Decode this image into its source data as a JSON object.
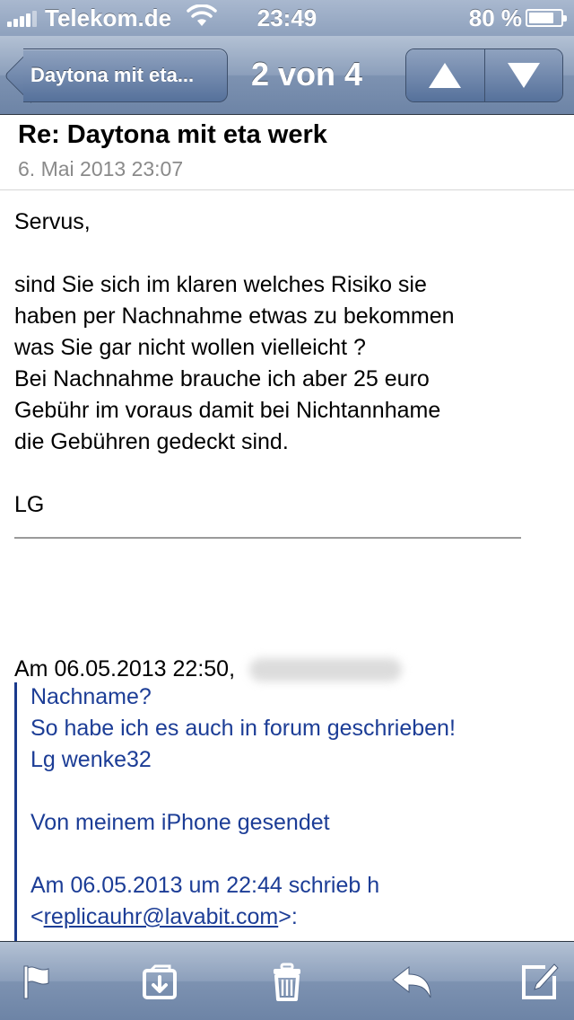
{
  "status_bar": {
    "carrier": "Telekom.de",
    "time": "23:49",
    "battery_percent": "80 %",
    "battery_level": 0.8,
    "signal_bars": 4
  },
  "nav": {
    "back_label": "Daytona mit eta...",
    "title": "2 von 4"
  },
  "message": {
    "subject": "Re: Daytona mit eta werk",
    "date": "6. Mai 2013 23:07",
    "body_lines": [
      "Servus,",
      "",
      "sind Sie sich im klaren welches Risiko sie",
      "haben per Nachnahme etwas zu bekommen",
      "was Sie gar nicht wollen vielleicht ?",
      "Bei Nachnahme brauche ich aber 25 euro",
      "Gebühr im voraus damit bei Nichtannhame",
      "die Gebühren gedeckt sind.",
      "",
      "LG"
    ],
    "quote_intro": "Am 06.05.2013 22:50,",
    "quote_lines": [
      "Nachname?",
      "So habe ich es auch in forum geschrieben!",
      "Lg wenke32",
      "",
      "Von meinem iPhone gesendet",
      "",
      "Am 06.05.2013 um 22:44 schrieb h"
    ],
    "quote_email_prefix": "<",
    "quote_email": "replicauhr@lavabit.com",
    "quote_email_suffix": ">:"
  },
  "toolbar": {
    "icons": [
      "flag-icon",
      "move-to-folder-icon",
      "trash-icon",
      "reply-icon",
      "compose-icon"
    ]
  },
  "colors": {
    "bar_blue": "#8c9fbb",
    "quote_text": "#1c3d96",
    "quote_bar": "#1a3a8c",
    "date_gray": "#8a8a8a"
  }
}
